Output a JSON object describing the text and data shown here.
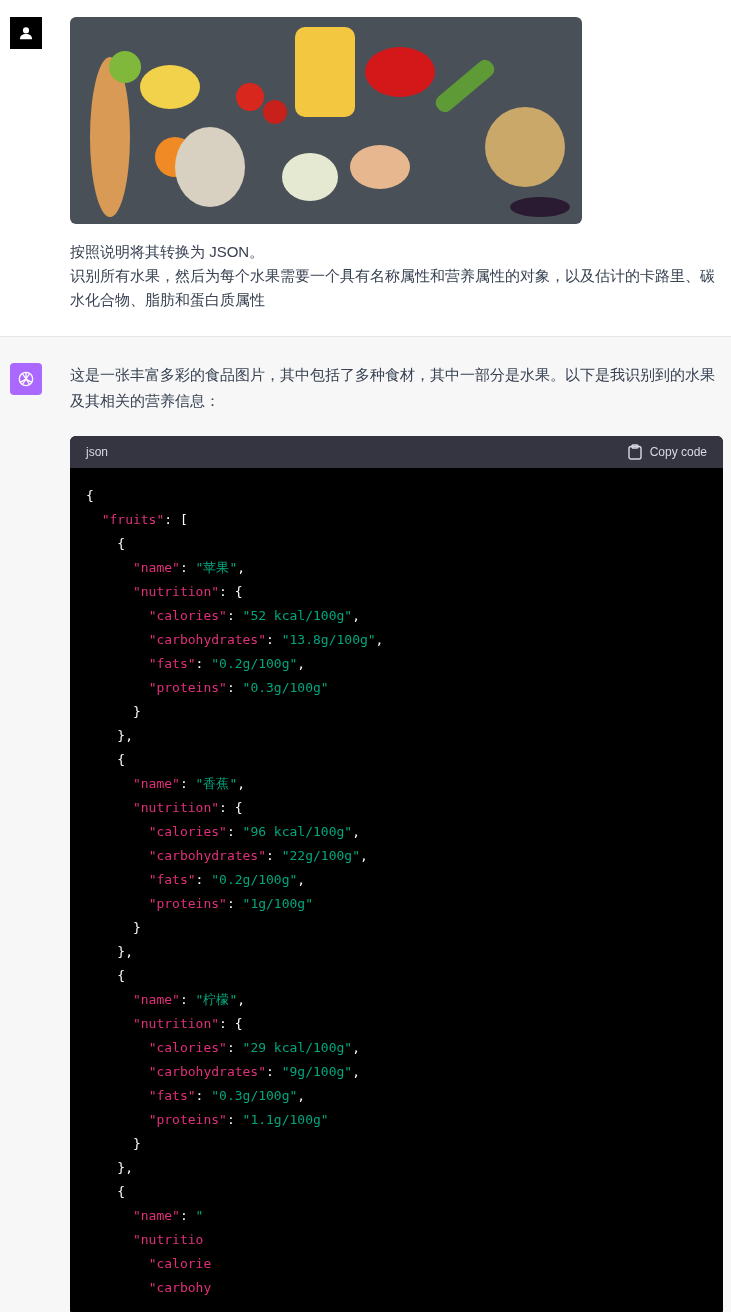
{
  "user_message": {
    "paragraphs": [
      "按照说明将其转换为 JSON。",
      "识别所有水果，然后为每个水果需要一个具有名称属性和营养属性的对象，以及估计的卡路里、碳水化合物、脂肪和蛋白质属性"
    ]
  },
  "assistant_message": {
    "text": "这是一张丰富多彩的食品图片，其中包括了多种食材，其中一部分是水果。以下是我识别到的水果及其相关的营养信息：",
    "code_block": {
      "language": "json",
      "copy_label": "Copy code",
      "lines": [
        "{",
        "  \"fruits\": [",
        "    {",
        "      \"name\": \"苹果\",",
        "      \"nutrition\": {",
        "        \"calories\": \"52 kcal/100g\",",
        "        \"carbohydrates\": \"13.8g/100g\",",
        "        \"fats\": \"0.2g/100g\",",
        "        \"proteins\": \"0.3g/100g\"",
        "      }",
        "    },",
        "    {",
        "      \"name\": \"香蕉\",",
        "      \"nutrition\": {",
        "        \"calories\": \"96 kcal/100g\",",
        "        \"carbohydrates\": \"22g/100g\",",
        "        \"fats\": \"0.2g/100g\",",
        "        \"proteins\": \"1g/100g\"",
        "      }",
        "    },",
        "    {",
        "      \"name\": \"柠檬\",",
        "      \"nutrition\": {",
        "        \"calories\": \"29 kcal/100g\",",
        "        \"carbohydrates\": \"9g/100g\",",
        "        \"fats\": \"0.3g/100g\",",
        "        \"proteins\": \"1.1g/100g\"",
        "      }",
        "    },",
        "    {",
        "      \"name\": \"",
        "      \"nutritio",
        "        \"calorie",
        "        \"carbohy"
      ]
    }
  }
}
